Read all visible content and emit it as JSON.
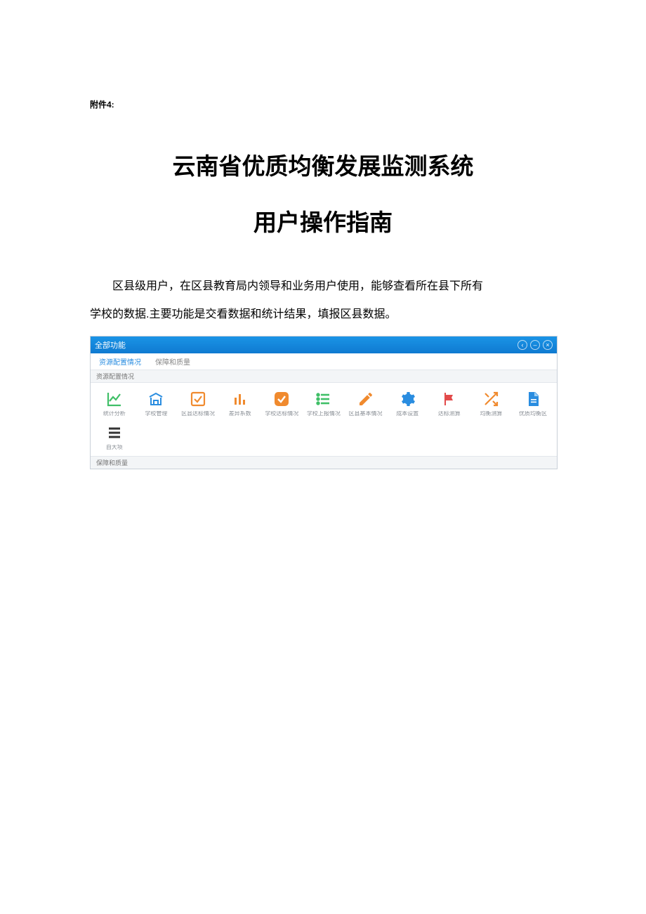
{
  "attachment_label": "附件4:",
  "title": "云南省优质均衡发展监测系统",
  "subtitle": "用户操作指南",
  "body": {
    "para1": "区县级用户，在区县教育局内领导和业务用户使用，能够查看所在县下所有",
    "para2": "学校的数据.主要功能是交看数据和统计结果，填报区县数据。"
  },
  "screenshot": {
    "window_title": "全部功能",
    "tabs": [
      "资源配置情况",
      "保障和质量"
    ],
    "active_tab_index": 0,
    "section_header": "资源配置情况",
    "footer_section": "保障和质量",
    "icons": [
      {
        "name": "chart-line-icon",
        "label": "统计分析",
        "color": "#3fbf67"
      },
      {
        "name": "building-icon",
        "label": "学校管理",
        "color": "#2a8de0"
      },
      {
        "name": "check-square-icon",
        "label": "区县达标情况",
        "color": "#f08a2e"
      },
      {
        "name": "bar-chart-icon",
        "label": "差异系数",
        "color": "#f08a2e"
      },
      {
        "name": "check-rounded-icon",
        "label": "学校达标情况",
        "color": "#f08a2e"
      },
      {
        "name": "list-icon",
        "label": "学校上报情况",
        "color": "#3fbf67"
      },
      {
        "name": "edit-icon",
        "label": "区县基本情况",
        "color": "#f08a2e"
      },
      {
        "name": "gear-icon",
        "label": "成本设置",
        "color": "#2a8de0"
      },
      {
        "name": "flag-icon",
        "label": "达标测算",
        "color": "#e24a4a"
      },
      {
        "name": "shuffle-icon",
        "label": "均衡测算",
        "color": "#f08a2e"
      },
      {
        "name": "file-icon",
        "label": "优质均衡区",
        "color": "#2a8de0"
      },
      {
        "name": "menu-icon",
        "label": "自大项",
        "color": "#333333"
      }
    ]
  }
}
